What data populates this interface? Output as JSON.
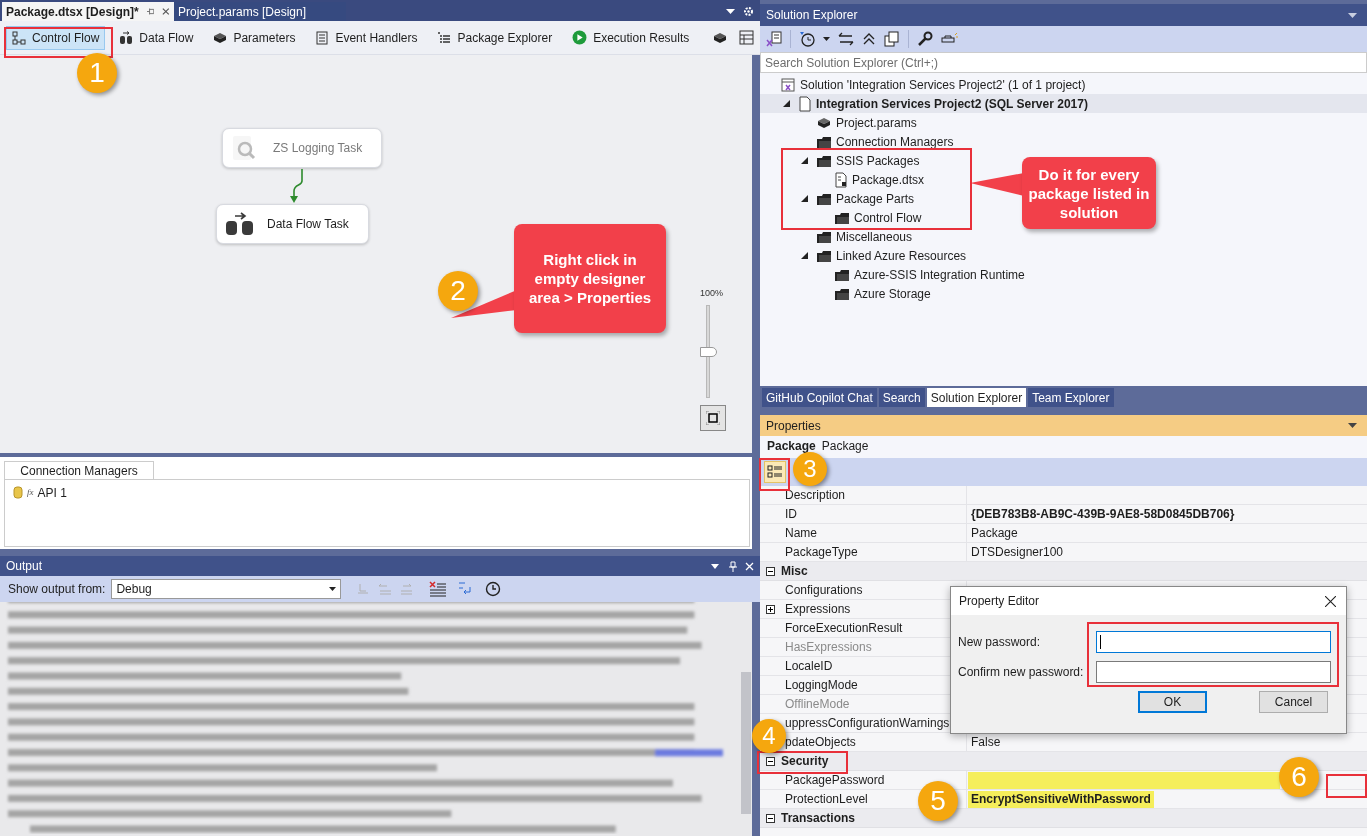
{
  "editor_tabs": [
    {
      "label": "Package.dtsx [Design]*",
      "selected": true
    },
    {
      "label": "Project.params [Design]",
      "selected": false
    }
  ],
  "designer_tabs": [
    {
      "label": "Control Flow",
      "kind": "flow",
      "selected": true
    },
    {
      "label": "Data Flow",
      "kind": "dataflow",
      "selected": false
    },
    {
      "label": "Parameters",
      "kind": "params",
      "selected": false
    },
    {
      "label": "Event Handlers",
      "kind": "events",
      "selected": false
    },
    {
      "label": "Package Explorer",
      "kind": "explorer",
      "selected": false
    },
    {
      "label": "Execution Results",
      "kind": "play",
      "selected": false
    }
  ],
  "canvas": {
    "tasks": [
      {
        "name": "ZS Logging Task",
        "kind": "logging",
        "disabled": true
      },
      {
        "name": "Data Flow Task",
        "kind": "dataflow",
        "disabled": false
      }
    ],
    "zoom": {
      "reading": "100%",
      "level": 0.5
    }
  },
  "connection_managers": {
    "tab": "Connection Managers",
    "items": [
      {
        "mark": "fx",
        "label": "API 1"
      }
    ]
  },
  "output": {
    "title": "Output",
    "source_label": "Show output from:",
    "source": "Debug"
  },
  "solution_explorer": {
    "title": "Solution Explorer",
    "search_placeholder": "Search Solution Explorer (Ctrl+;)",
    "tree": [
      {
        "label": "Solution 'Integration Services Project2' (1 of 1 project)",
        "kind": "solution",
        "selected": false,
        "children": [
          {
            "label": "Integration Services Project2 (SQL Server 2017)",
            "kind": "project",
            "bold": true,
            "selected": true,
            "expanded": true,
            "children": [
              {
                "label": "Project.params",
                "kind": "params",
                "selected": false
              },
              {
                "label": "Connection Managers",
                "kind": "folder",
                "selected": false
              },
              {
                "label": "SSIS Packages",
                "kind": "folder",
                "selected": false,
                "expanded": true,
                "children": [
                  {
                    "label": "Package.dtsx",
                    "kind": "package",
                    "selected": false
                  }
                ]
              },
              {
                "label": "Package Parts",
                "kind": "folder",
                "selected": false,
                "expanded": true,
                "children": [
                  {
                    "label": "Control Flow",
                    "kind": "folder",
                    "selected": false
                  }
                ]
              },
              {
                "label": "Miscellaneous",
                "kind": "folder",
                "selected": false
              },
              {
                "label": "Linked Azure Resources",
                "kind": "folder",
                "selected": false,
                "expanded": true,
                "children": [
                  {
                    "label": "Azure-SSIS Integration Runtime",
                    "kind": "folder",
                    "selected": false
                  },
                  {
                    "label": "Azure Storage",
                    "kind": "folder",
                    "selected": false
                  }
                ]
              }
            ]
          }
        ]
      }
    ]
  },
  "tool_tabs": [
    {
      "label": "GitHub Copilot Chat",
      "selected": false
    },
    {
      "label": "Search",
      "selected": false
    },
    {
      "label": "Solution Explorer",
      "selected": true
    },
    {
      "label": "Team Explorer",
      "selected": false
    }
  ],
  "properties": {
    "title": "Properties",
    "object_name": "Package",
    "object_type": "Package",
    "rows": [
      {
        "kind": "property",
        "name": "Description",
        "disabled": false
      },
      {
        "kind": "property",
        "name": "ID",
        "value": "{DEB783B8-AB9C-439B-9AE8-58D0845DB706}",
        "disabled": false,
        "modified": true,
        "highlighted": false
      },
      {
        "kind": "property",
        "name": "Name",
        "value": "Package",
        "disabled": false,
        "modified": false,
        "highlighted": false
      },
      {
        "kind": "property",
        "name": "PackageType",
        "value": "DTSDesigner100",
        "disabled": false,
        "modified": false,
        "highlighted": false
      },
      {
        "kind": "category",
        "name": "Misc",
        "expanded": true
      },
      {
        "kind": "property",
        "name": "Configurations",
        "disabled": false
      },
      {
        "kind": "property",
        "name": "Expressions",
        "expanded": false,
        "disabled": false
      },
      {
        "kind": "property",
        "name": "ForceExecutionResult",
        "disabled": false
      },
      {
        "kind": "property",
        "name": "HasExpressions",
        "disabled": true
      },
      {
        "kind": "property",
        "name": "LocaleID",
        "disabled": false
      },
      {
        "kind": "property",
        "name": "LoggingMode",
        "disabled": false
      },
      {
        "kind": "property",
        "name": "OfflineMode",
        "disabled": true
      },
      {
        "kind": "property",
        "name": "uppressConfigurationWarnings",
        "disabled": false
      },
      {
        "kind": "property",
        "name": "pdateObjects",
        "value": "False",
        "disabled": false,
        "modified": false,
        "highlighted": false
      },
      {
        "kind": "category",
        "name": "Security",
        "expanded": true
      },
      {
        "kind": "property",
        "name": "PackagePassword",
        "disabled": false,
        "highlighted": true
      },
      {
        "kind": "property",
        "name": "ProtectionLevel",
        "value": "EncryptSensitiveWithPassword",
        "disabled": false,
        "modified": true,
        "highlighted": true
      },
      {
        "kind": "category",
        "name": "Transactions",
        "expanded": true
      }
    ]
  },
  "dialog": {
    "title": "Property Editor",
    "fields": [
      {
        "label": "New password:",
        "focused": true
      },
      {
        "label": "Confirm new password:",
        "focused": false
      }
    ],
    "buttons": [
      {
        "label": "OK",
        "default": true
      },
      {
        "label": "Cancel",
        "default": false
      }
    ]
  },
  "annotations": {
    "badges": [
      "1",
      "2",
      "3",
      "4",
      "5",
      "6"
    ],
    "callouts": [
      "Right click in empty designer area > Properties",
      "Do it for every package listed in solution"
    ]
  }
}
